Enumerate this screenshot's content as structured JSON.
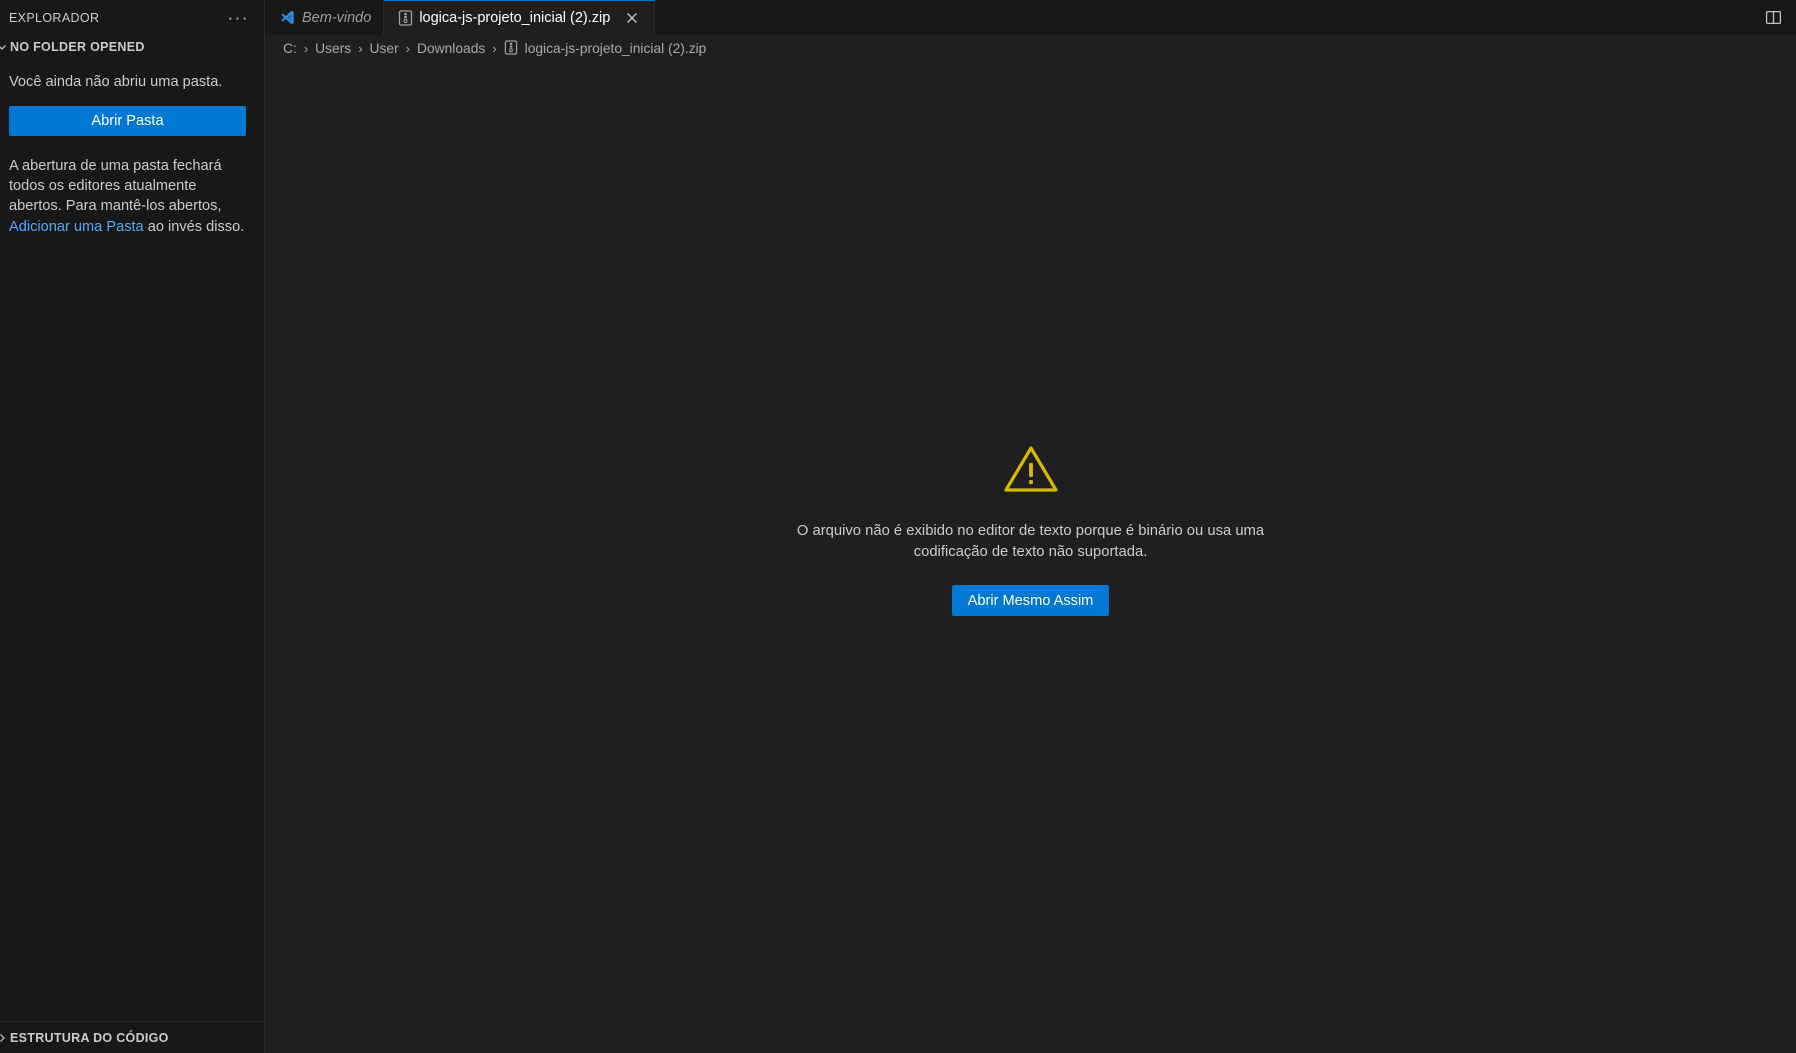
{
  "sidebar": {
    "title": "EXPLORADOR",
    "more_icon": "ellipsis-icon",
    "section": {
      "label": "NO FOLDER OPENED",
      "chevron": "chevron-down-icon"
    },
    "no_folder_text": "Você ainda não abriu uma pasta.",
    "open_folder_button": "Abrir Pasta",
    "info_text_before": "A abertura de uma pasta fechará todos os editores atualmente abertos. Para mantê-los abertos, ",
    "info_link": "Adicionar uma Pasta",
    "info_text_after": " ao invés disso.",
    "bottom_section": {
      "label": "ESTRUTURA DO CÓDIGO",
      "chevron": "chevron-right-icon"
    }
  },
  "tabbar": {
    "tabs": [
      {
        "label": "Bem-vindo",
        "icon": "vscode-logo-icon",
        "active": false,
        "preview": true,
        "closable": false
      },
      {
        "label": "logica-js-projeto_inicial (2).zip",
        "icon": "zip-file-icon",
        "active": true,
        "preview": false,
        "closable": true,
        "close_icon": "close-icon"
      }
    ],
    "layout_icon": "editor-layout-icon"
  },
  "breadcrumb": {
    "separator": "›",
    "items": [
      {
        "label": "C:",
        "icon": null
      },
      {
        "label": "Users",
        "icon": null
      },
      {
        "label": "User",
        "icon": null
      },
      {
        "label": "Downloads",
        "icon": null
      },
      {
        "label": "logica-js-projeto_inicial (2).zip",
        "icon": "zip-file-icon"
      }
    ]
  },
  "editor": {
    "warning_icon": "warning-triangle-icon",
    "binary_message": "O arquivo não é exibido no editor de texto porque é binário ou usa uma codificação de texto não suportada.",
    "open_anyway_button": "Abrir Mesmo Assim"
  },
  "colors": {
    "accent": "#0078d4",
    "link": "#4daafc",
    "warning": "#d7ba00",
    "sidebar_bg": "#181818",
    "editor_bg": "#1f1f1f",
    "border": "#2b2b2b",
    "text": "#cccccc"
  }
}
